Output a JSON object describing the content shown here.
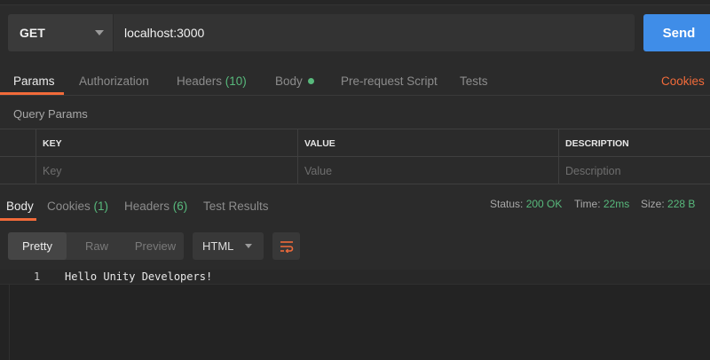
{
  "request": {
    "method": "GET",
    "url": "localhost:3000",
    "send_label": "Send"
  },
  "request_tabs": {
    "params": "Params",
    "authorization": "Authorization",
    "headers": "Headers",
    "headers_count": "(10)",
    "body": "Body",
    "pre_request_script": "Pre-request Script",
    "tests": "Tests",
    "cookies": "Cookies"
  },
  "query_params": {
    "title": "Query Params",
    "columns": [
      "KEY",
      "VALUE",
      "DESCRIPTION"
    ],
    "placeholders": [
      "Key",
      "Value",
      "Description"
    ]
  },
  "response_tabs": {
    "body": "Body",
    "cookies": "Cookies",
    "cookies_count": "(1)",
    "headers": "Headers",
    "headers_count": "(6)",
    "test_results": "Test Results"
  },
  "response_status": {
    "status_label": "Status:",
    "status_value": "200 OK",
    "time_label": "Time:",
    "time_value": "22ms",
    "size_label": "Size:",
    "size_value": "228 B"
  },
  "view_controls": {
    "pretty": "Pretty",
    "raw": "Raw",
    "preview": "Preview",
    "format": "HTML"
  },
  "response_body": {
    "line_number": "1",
    "line_text": "Hello Unity Developers!"
  },
  "colors": {
    "accent": "#f26b3a",
    "send": "#3f8de8",
    "success": "#58b97c",
    "background": "#2b2b2b"
  }
}
